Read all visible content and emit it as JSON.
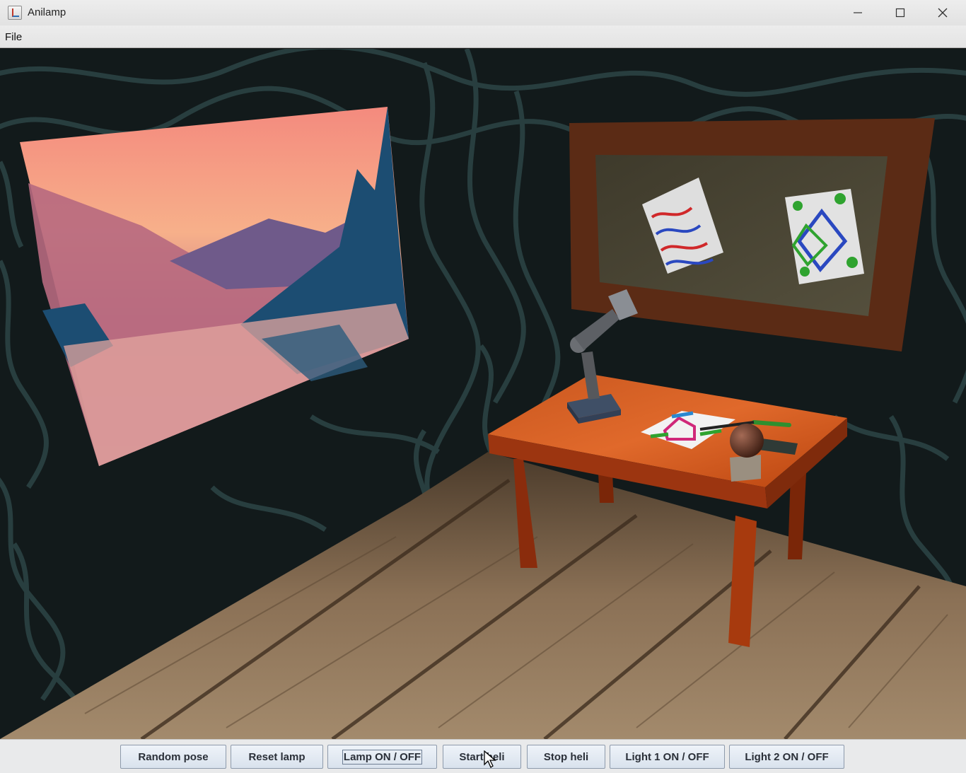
{
  "window": {
    "title": "Anilamp"
  },
  "menu": {
    "items": [
      "File"
    ]
  },
  "controls": {
    "buttons": [
      {
        "label": "Random pose"
      },
      {
        "label": "Reset lamp"
      },
      {
        "label": "Lamp ON / OFF"
      },
      {
        "label": "Start heli"
      },
      {
        "label": "Stop heli"
      },
      {
        "label": "Light 1 ON / OFF"
      },
      {
        "label": "Light 2 ON / OFF"
      }
    ]
  },
  "colors": {
    "wall": "#141b1c",
    "wall_pattern": "#2a4142",
    "floor": "#8b7153",
    "table": "#c24a14",
    "frame": "#5a2a15",
    "board": "#4a4534"
  }
}
